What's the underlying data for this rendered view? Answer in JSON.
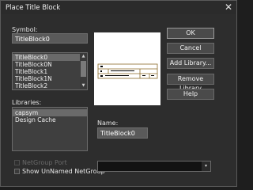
{
  "dialog": {
    "title": "Place Title Block",
    "close_glyph": "✕"
  },
  "symbol": {
    "label": "Symbol:",
    "value": "TitleBlock0",
    "items": [
      "TitleBlock0",
      "TitleBlock0N",
      "TitleBlock1",
      "TitleBlock1N",
      "TitleBlock2"
    ],
    "selected_index": 0
  },
  "libraries": {
    "label": "Libraries:",
    "items": [
      "capsym",
      "Design Cache"
    ],
    "selected_index": 0
  },
  "name": {
    "label": "Name:",
    "value": "TitleBlock0"
  },
  "buttons": {
    "ok": "OK",
    "cancel": "Cancel",
    "add_library": "Add Library...",
    "remove_library": "Remove Library",
    "help": "Help"
  },
  "options": {
    "netgroup_port": {
      "label": "NetGroup Port",
      "checked": false,
      "enabled": false
    },
    "show_unnamed_netgroup": {
      "label": "Show UnNamed NetGroup",
      "checked": false,
      "enabled": true
    }
  },
  "netgroup_combo": {
    "value": ""
  },
  "icons": {
    "scroll_up": "▲",
    "scroll_down": "▼",
    "combo_arrow": "▾"
  },
  "colors": {
    "background": "#2d2d2d",
    "field": "#5a5a5a",
    "list": "#3f3f3f",
    "preview": "#ffffff",
    "title_block_line": "#8b6a28"
  }
}
